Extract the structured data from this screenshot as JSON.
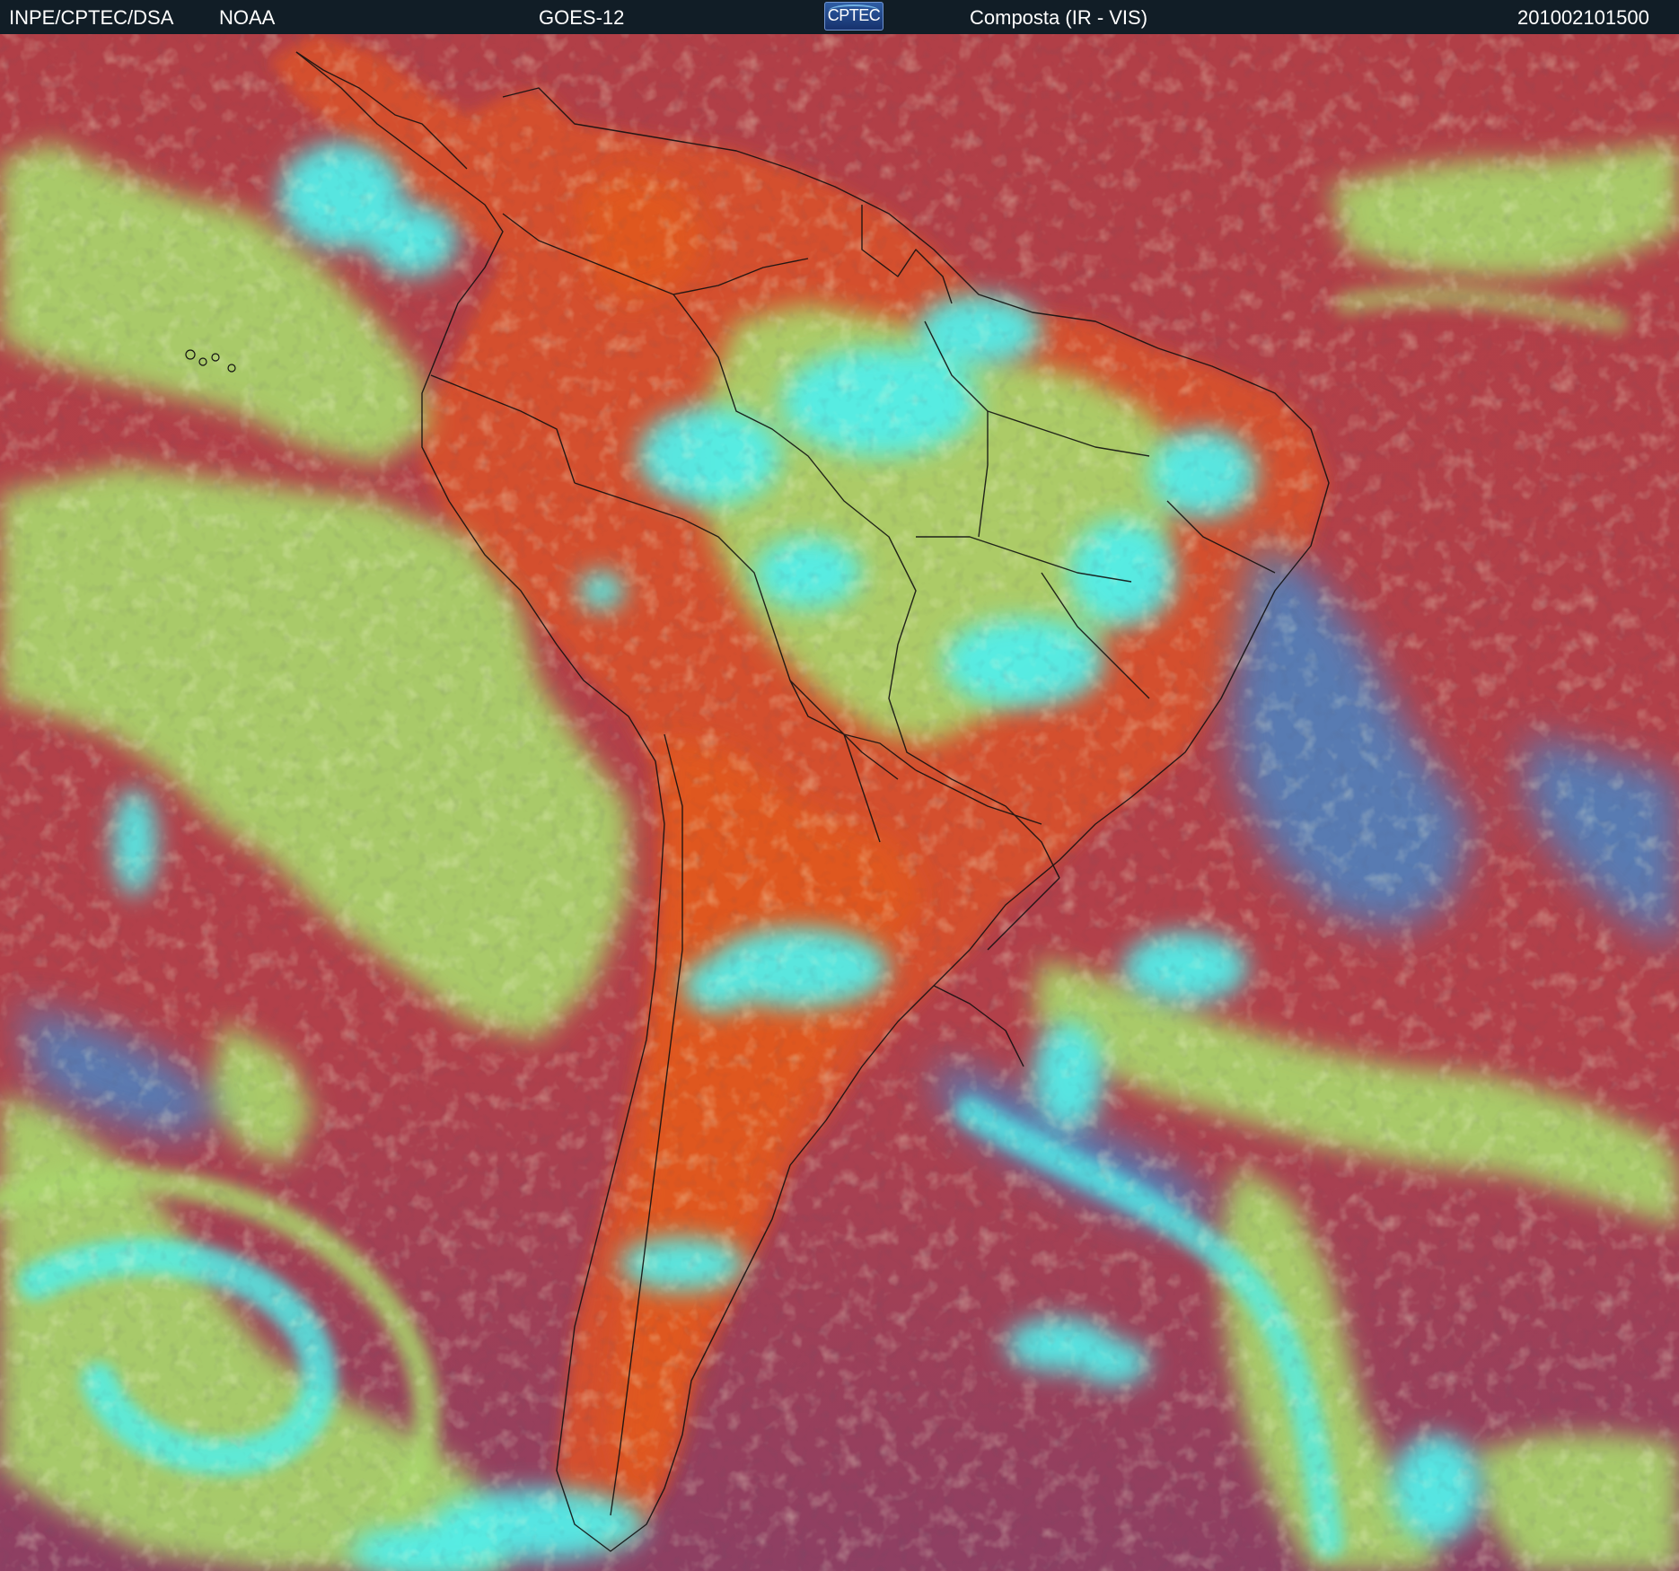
{
  "header": {
    "source": "INPE/CPTEC/DSA",
    "agency": "NOAA",
    "satellite": "GOES-12",
    "logo_text": "CPTEC",
    "product": "Composta (IR - VIS)",
    "timestamp": "201002101500"
  },
  "colors": {
    "header_bg": "#111d26",
    "ocean_clear": "#b2404a",
    "land_clear": "#d8552f",
    "low_cloud": "#a8d86a",
    "high_cloud": "#4ff0ec",
    "mid_cloud": "#3f95d8",
    "border_lines": "#111111"
  }
}
